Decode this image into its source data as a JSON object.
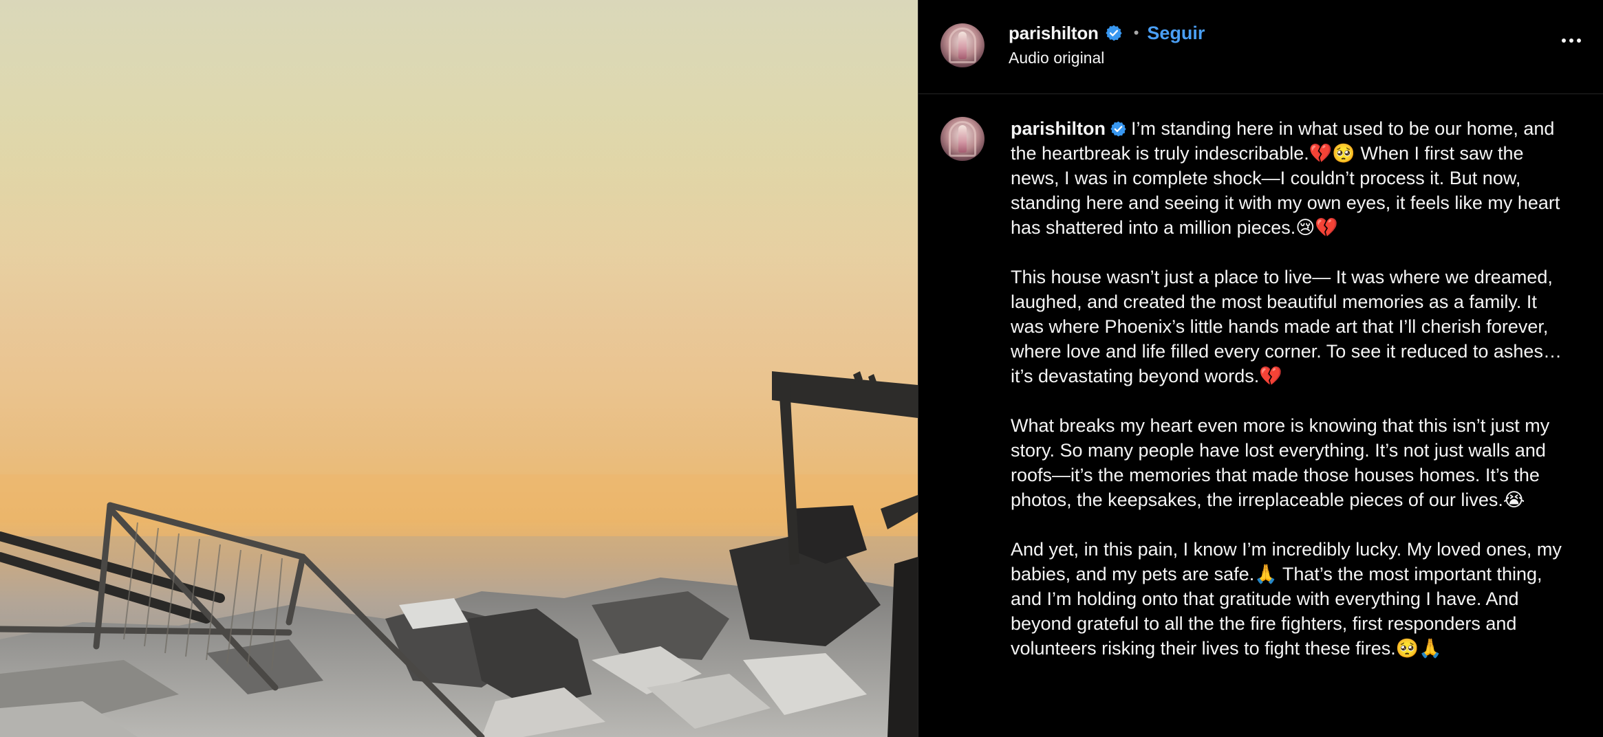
{
  "header": {
    "username": "parishilton",
    "separator": "•",
    "follow_label": "Seguir",
    "audio_label": "Audio original",
    "more_icon": "more-horizontal-icon"
  },
  "caption": {
    "username": "parishilton",
    "paragraph_1": "I’m standing here in what used to be our home, and the heartbreak is truly indescribable.💔🥺 When I first saw the news, I was in complete shock—I couldn’t process it. But now, standing here and seeing it with my own eyes, it feels like my heart has shattered into a million pieces.😢💔",
    "paragraph_2": "This house wasn’t just a place to live— It was where we dreamed, laughed, and created the most beautiful memories as a family. It was where Phoenix’s little hands made art that I’ll cherish forever, where love and life filled every corner. To see it reduced to ashes… it’s devastating beyond words.💔",
    "paragraph_3": "What breaks my heart even more is knowing that this isn’t just my story. So many people have lost everything. It’s not just walls and roofs—it’s the memories that made those houses homes. It’s the photos, the keepsakes, the irreplaceable pieces of our lives.😭",
    "paragraph_4": "And yet, in this pain, I know I’m incredibly lucky. My loved ones, my babies, and my pets are safe.🙏 That’s the most important thing, and I’m holding onto that gratitude with everything I have. And beyond grateful to all the the fire fighters, first responders and volunteers risking their lives to fight these fires.🥺🙏"
  },
  "colors": {
    "follow": "#4a9ff5",
    "verified": "#3897f0",
    "background": "#000000",
    "text": "#f5f5f5"
  }
}
